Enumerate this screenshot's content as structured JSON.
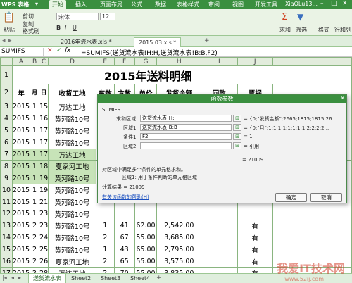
{
  "app": {
    "logo": "WPS 表格",
    "menus": [
      "开始",
      "插入",
      "页面布局",
      "公式",
      "数据",
      "表格样式",
      "审阅",
      "视图",
      "开发工具"
    ],
    "user": "XiaOLu13..."
  },
  "ribbon": {
    "paste": "粘贴",
    "cut": "剪切",
    "copy": "复制",
    "format_painter": "格式刷",
    "font": "宋体",
    "font_size": "12",
    "sum": "求和",
    "filter": "筛选",
    "format": "格式",
    "rowcol": "行和列"
  },
  "doc_tabs": [
    "2016年流水表.xls *",
    "2015.03.xls *"
  ],
  "formula_bar": {
    "name_box": "SUMIFS",
    "formula": "=SUMIFS(送货流水表!H:H,送货流水表!B:B,F2)"
  },
  "sheet": {
    "columns": [
      "",
      "A",
      "B",
      "C",
      "D",
      "E",
      "F",
      "G",
      "H",
      "I",
      "J"
    ],
    "title": "2015年送料明细",
    "headers": [
      "年",
      "月",
      "日",
      "收货工地",
      "车数",
      "方数",
      "单价",
      "发货金额",
      "回款",
      "票据"
    ],
    "rows": [
      [
        "3",
        "2015",
        "1",
        "15",
        "万达工地",
        "",
        "",
        "",
        "",
        "",
        ""
      ],
      [
        "4",
        "2015",
        "1",
        "16",
        "黄河路10号",
        "",
        "",
        "",
        "",
        "",
        ""
      ],
      [
        "5",
        "2015",
        "1",
        "17",
        "黄河路10号",
        "",
        "",
        "",
        "",
        "",
        ""
      ],
      [
        "6",
        "2015",
        "1",
        "17",
        "黄河路10号",
        "",
        "",
        "",
        "",
        "",
        ""
      ],
      [
        "7",
        "2015",
        "1",
        "17",
        "万达工地",
        "",
        "",
        "",
        "",
        "",
        ""
      ],
      [
        "8",
        "2015",
        "1",
        "18",
        "夏家河工地",
        "",
        "",
        "",
        "",
        "",
        ""
      ],
      [
        "9",
        "2015",
        "1",
        "19",
        "黄河路10号",
        "",
        "",
        "",
        "",
        "",
        ""
      ],
      [
        "10",
        "2015",
        "1",
        "19",
        "黄河路10号",
        "",
        "",
        "",
        "",
        "",
        ""
      ],
      [
        "11",
        "2015",
        "1",
        "21",
        "黄河路10号",
        "",
        "",
        "",
        "",
        "",
        ""
      ],
      [
        "12",
        "2015",
        "1",
        "23",
        "黄河路10号",
        "",
        "",
        "",
        "",
        "",
        ""
      ],
      [
        "13",
        "2015",
        "2",
        "23",
        "黄河路10号",
        "1",
        "41",
        "62.00",
        "2,542.00",
        "",
        "有"
      ],
      [
        "14",
        "2015",
        "2",
        "24",
        "黄河路10号",
        "2",
        "67",
        "55.00",
        "3,685.00",
        "",
        "有"
      ],
      [
        "15",
        "2015",
        "2",
        "25",
        "黄河路10号",
        "1",
        "43",
        "65.00",
        "2,795.00",
        "",
        "有"
      ],
      [
        "16",
        "2015",
        "2",
        "26",
        "夏家河工地",
        "2",
        "65",
        "55.00",
        "3,575.00",
        "",
        "有"
      ],
      [
        "17",
        "2015",
        "2",
        "28",
        "万达工地",
        "2",
        "70",
        "55.00",
        "3,835.00",
        "",
        "有"
      ],
      [
        "18",
        "2015",
        "2",
        "28",
        "黄河路10号",
        "1",
        "34",
        "55.00",
        "1,870.00",
        "",
        "有"
      ]
    ]
  },
  "dialog": {
    "title": "函数参数",
    "func_name": "SUMIFS",
    "params": [
      {
        "label": "求和区域",
        "value": "送货流水表!H:H",
        "result": "= {0;\"发货金额\";2665;1815;1815;26..."
      },
      {
        "label": "区域1",
        "value": "送货流水表!B:B",
        "result": "= {0;\"月\";1;1;1;1;1;1;1;1;2;2;2;2..."
      },
      {
        "label": "条件1",
        "value": "F2",
        "result": "= 1"
      },
      {
        "label": "区域2",
        "value": "",
        "result": "= 引用"
      }
    ],
    "value_result": "= 21009",
    "desc": "对区域中满足多个条件的单元格求和。",
    "desc2": "区域1: 用于条件判断的单元格区域",
    "calc_result": "计算结果 = 21009",
    "help_link": "有关该函数的帮助(H)",
    "ok": "确定",
    "cancel": "取消"
  },
  "sheet_tabs": [
    "送货流水表",
    "Sheet2",
    "Sheet3",
    "Sheet4"
  ],
  "watermark": {
    "main": "我爱IT技术网",
    "sub": "www.52ij.com"
  }
}
